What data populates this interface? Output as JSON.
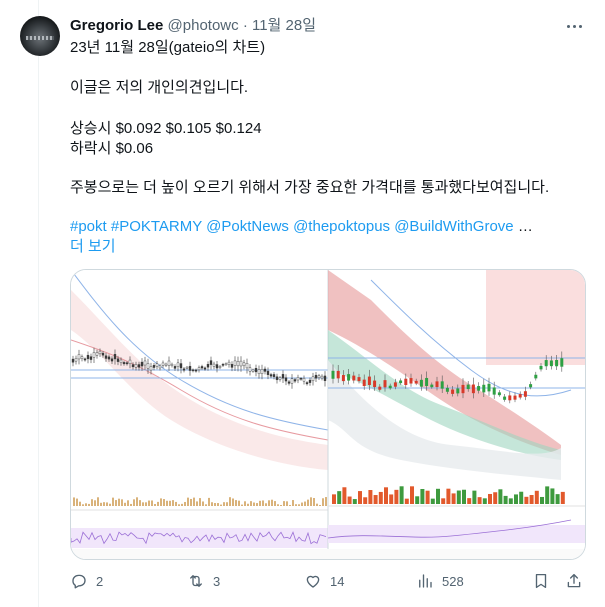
{
  "tweet": {
    "author_name": "Gregorio Lee",
    "handle": "@photowc",
    "separator": "·",
    "date": "11월 28일",
    "lines": [
      "23년 11월 28일(gateio의 차트)",
      "이글은 저의 개인의견입니다.",
      "상승시 $0.092 $0.105 $0.124",
      "하락시 $0.06",
      "주봉으로는 더 높이 오르기 위해서 가장 중요한 가격대를 통과했다보여집니다."
    ],
    "hashtags": "#pokt #POKTARMY @PoktNews @thepoktopus @BuildWithGrove",
    "ellipsis": "…",
    "show_more": "더 보기"
  },
  "actions": {
    "replies": "2",
    "retweets": "3",
    "likes": "14",
    "views": "528"
  },
  "colors": {
    "link": "#1d9bf0",
    "muted": "#536471",
    "candle_up": "#2ea043",
    "candle_down": "#d73a2a",
    "cloud_red": "#e8a0a0",
    "cloud_green": "#9ed6c0"
  }
}
